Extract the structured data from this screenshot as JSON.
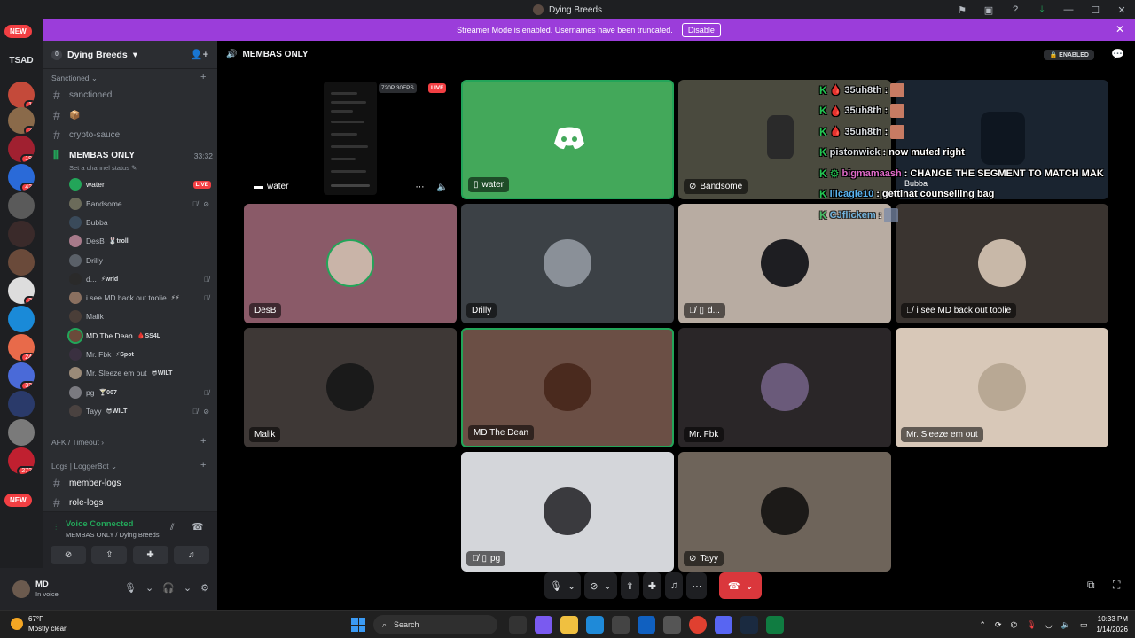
{
  "window": {
    "title": "Dying Breeds",
    "controls": [
      "—",
      "☐",
      "✕"
    ]
  },
  "banner": {
    "text": "Streamer Mode is enabled. Usernames have been truncated.",
    "button": "Disable"
  },
  "guilds": {
    "new_top": "NEW",
    "tsad": "TSAD",
    "new_bottom": "NEW",
    "badges": [
      "1",
      "2",
      "19",
      "42",
      "3",
      "24",
      "32",
      "272"
    ]
  },
  "server": {
    "name": "Dying Breeds",
    "badge_count": "0"
  },
  "categories": {
    "sanctioned": "Sanctioned",
    "afk": "AFK / Timeout",
    "logs": "Logs | LoggerBot"
  },
  "channels": {
    "sanctioned": "sanctioned",
    "box": "📦",
    "crypto": "crypto-sauce",
    "voice": "MEMBAS ONLY",
    "voice_timer": "33:32",
    "voice_status": "Set a channel status",
    "member_logs": "member-logs",
    "role_logs": "role-logs"
  },
  "members": [
    {
      "name": "water",
      "live": "LIVE",
      "color": "#23a559"
    },
    {
      "name": "Bandsome",
      "color": "#6b6b5a"
    },
    {
      "name": "Bubba",
      "color": "#3a4a5a"
    },
    {
      "name": "DesB",
      "tag": "🐰troll",
      "color": "#a77a8a"
    },
    {
      "name": "Drilly",
      "color": "#5a6068"
    },
    {
      "name": "d...",
      "tag": "⚡wrld",
      "color": "#2a2a2a"
    },
    {
      "name": "i see MD back out toolie",
      "tag": "⚡⚡",
      "color": "#8a7060"
    },
    {
      "name": "Malik",
      "color": "#4a3e38"
    },
    {
      "name": "MD The Dean",
      "tag": "🩸SS4L",
      "color": "#6b4a3a"
    },
    {
      "name": "Mr. Fbk",
      "tag": "⚡Spot",
      "color": "#3a3040"
    },
    {
      "name": "Mr. Sleeze em out",
      "tag": "😎WILT",
      "color": "#9a8a78"
    },
    {
      "name": "pg",
      "tag": "🍸007",
      "color": "#7a7a80"
    },
    {
      "name": "Tayy",
      "tag": "😎WILT",
      "color": "#4a4240"
    }
  ],
  "voice_panel": {
    "status": "Voice Connected",
    "location": "MEMBAS ONLY / Dying Breeds"
  },
  "user": {
    "name": "MD",
    "status": "In voice"
  },
  "stage": {
    "channel": "MEMBAS ONLY",
    "enabled": "ENABLED"
  },
  "tiles": {
    "stream": {
      "name": "water",
      "res": "720P 30FPS",
      "live": "LIVE"
    },
    "water": {
      "name": "water"
    },
    "bandsome": {
      "name": "Bandsome"
    },
    "bubba": {
      "name": "Bubba"
    },
    "desb": {
      "name": "DesB"
    },
    "drilly": {
      "name": "Drilly"
    },
    "d": {
      "name": "d..."
    },
    "isee": {
      "name": "i see MD back out toolie"
    },
    "malik": {
      "name": "Malik"
    },
    "mdthedean": {
      "name": "MD The Dean"
    },
    "mrfbk": {
      "name": "Mr. Fbk"
    },
    "sleeze": {
      "name": "Mr. Sleeze em out"
    },
    "pg": {
      "name": "pg"
    },
    "tayy": {
      "name": "Tayy"
    }
  },
  "chat": [
    {
      "user": "35uh8th",
      "msg": ""
    },
    {
      "user": "35uh8th",
      "msg": ""
    },
    {
      "user": "35uh8th",
      "msg": ""
    },
    {
      "user": "pistonwick",
      "msg": "now muted right"
    },
    {
      "user": "bigmamaash",
      "msg": "CHANGE THE SEGMENT TO MATCH MAK"
    },
    {
      "user": "lilcagle10",
      "msg": "gettinat counselling bag"
    },
    {
      "user": "CJflickem",
      "msg": ""
    }
  ],
  "taskbar": {
    "temp": "67°F",
    "weather": "Mostly clear",
    "search": "Search",
    "time": "10:33 PM",
    "date": "1/14/2026"
  },
  "colors": {
    "accent_green": "#23a559",
    "banner_purple": "#9b3dda",
    "live_red": "#f23f43"
  }
}
